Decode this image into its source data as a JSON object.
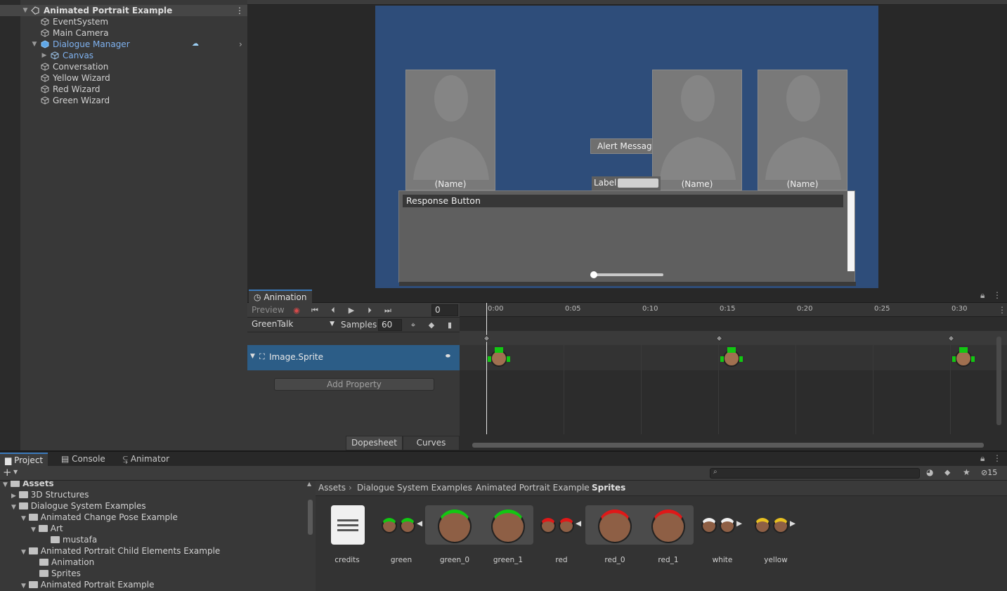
{
  "hierarchy": {
    "scene": "Animated Portrait Example",
    "items": [
      {
        "label": "EventSystem"
      },
      {
        "label": "Main Camera"
      },
      {
        "label": "Dialogue Manager"
      },
      {
        "label": "Canvas"
      },
      {
        "label": "Conversation"
      },
      {
        "label": "Yellow Wizard"
      },
      {
        "label": "Red Wizard"
      },
      {
        "label": "Green Wizard"
      }
    ]
  },
  "game": {
    "portrait_names": [
      "(Name)",
      "(Name)",
      "(Name)"
    ],
    "alert": "Alert Message",
    "label": "Label",
    "response_button": "Response Button"
  },
  "animation": {
    "tab": "Animation",
    "preview": "Preview",
    "frame": "0",
    "clip": "GreenTalk",
    "samples_label": "Samples",
    "samples": "60",
    "property": "Image.Sprite",
    "add_property": "Add Property",
    "dopesheet": "Dopesheet",
    "curves": "Curves",
    "timeline_labels": [
      "0:00",
      "0:05",
      "0:10",
      "0:15",
      "0:20",
      "0:25",
      "0:30"
    ]
  },
  "project": {
    "tabs": [
      "Project",
      "Console",
      "Animator"
    ],
    "hidden_count": "15",
    "tree": [
      {
        "label": "Assets"
      },
      {
        "label": "3D Structures"
      },
      {
        "label": "Dialogue System Examples"
      },
      {
        "label": "Animated Change Pose Example"
      },
      {
        "label": "Art"
      },
      {
        "label": "mustafa"
      },
      {
        "label": "Animated Portrait Child Elements Example"
      },
      {
        "label": "Animation"
      },
      {
        "label": "Sprites"
      },
      {
        "label": "Animated Portrait Example"
      }
    ],
    "breadcrumb": [
      "Assets",
      "Dialogue System Examples",
      "Animated Portrait Example",
      "Sprites"
    ],
    "assets": [
      {
        "label": "credits"
      },
      {
        "label": "green"
      },
      {
        "label": "green_0"
      },
      {
        "label": "green_1"
      },
      {
        "label": "red"
      },
      {
        "label": "red_0"
      },
      {
        "label": "red_1"
      },
      {
        "label": "white"
      },
      {
        "label": "yellow"
      }
    ]
  },
  "colors": {
    "accent": "#3a79bb",
    "selected_row": "#2c5d87",
    "game_bg": "#2e4d7a",
    "green": "#12c712",
    "red": "#e01818",
    "yellow": "#e8c020"
  }
}
